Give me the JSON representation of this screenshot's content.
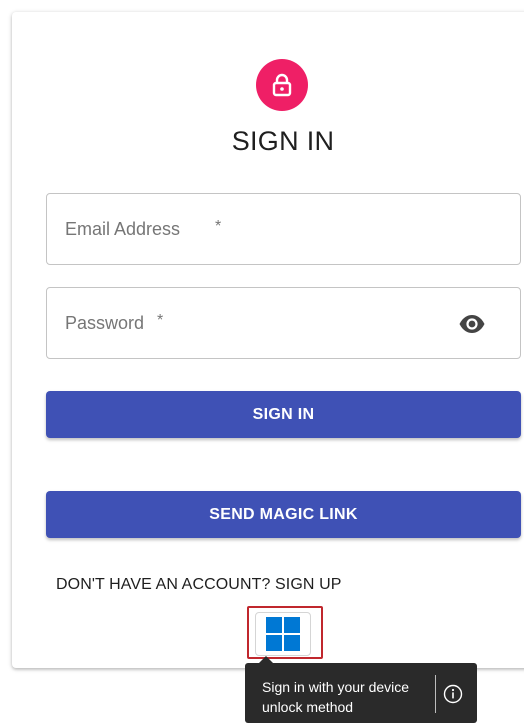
{
  "title": "SIGN IN",
  "email": {
    "placeholder": "Email Address",
    "required_mark": "*",
    "value": ""
  },
  "password": {
    "placeholder": "Password",
    "required_mark": "*",
    "value": ""
  },
  "buttons": {
    "sign_in": "SIGN IN",
    "send_magic_link": "SEND MAGIC LINK"
  },
  "signup_link": "DON'T HAVE AN ACCOUNT? SIGN UP",
  "tooltip": {
    "text": "Sign in with your device unlock method"
  },
  "icons": {
    "avatar": "lock-icon",
    "password_toggle": "eye-icon",
    "device_signin": "windows-logo-icon",
    "tooltip_info": "info-icon"
  },
  "colors": {
    "avatar_bg": "#ef1f66",
    "primary_button": "#3f51b5",
    "highlight_border": "#c0272d",
    "tooltip_bg": "#2a2a2a",
    "windows_blue": "#0078d4"
  }
}
